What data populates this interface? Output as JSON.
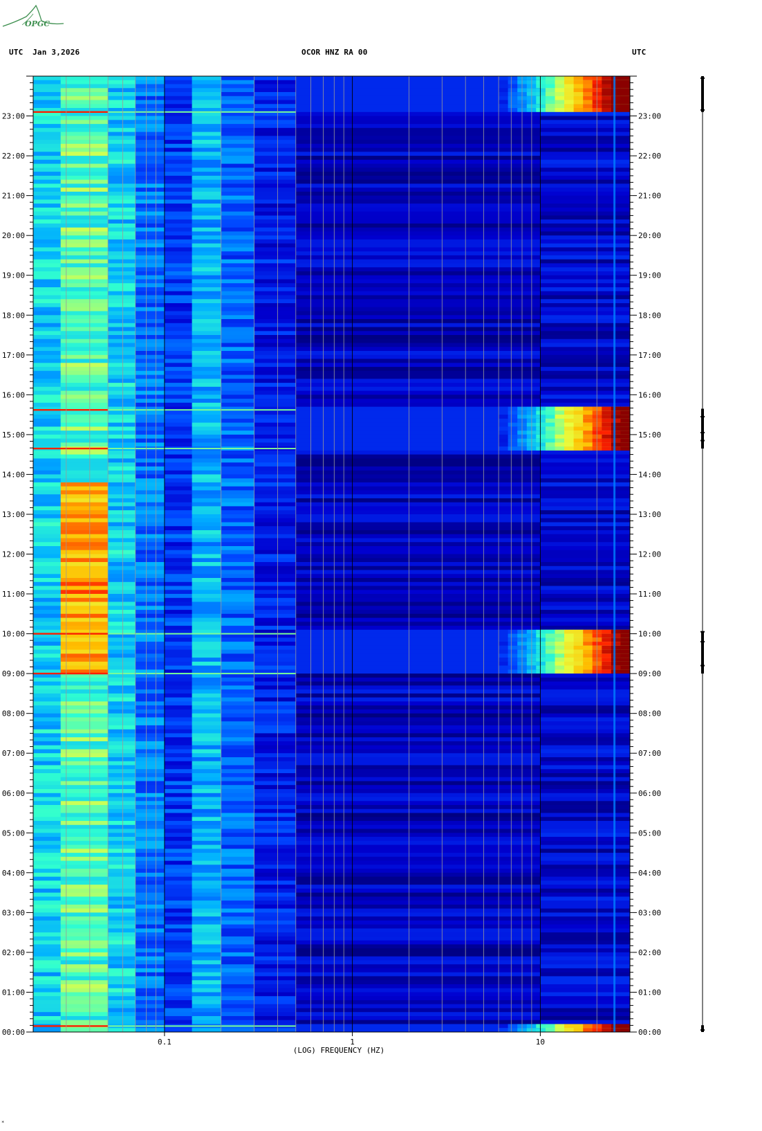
{
  "header": {
    "left": "UTC  Jan 3,2026",
    "center": "OCOR HNZ RA 00",
    "right": "UTC"
  },
  "logo": {
    "text": "OPGC",
    "color": "#3d8f4f"
  },
  "bottom_mark": "*",
  "chart_data": {
    "type": "heatmap",
    "title": "OCOR HNZ RA 00",
    "date": "Jan 3,2026",
    "xlabel": "(LOG) FREQUENCY (HZ)",
    "ylabel": "UTC",
    "x_scale": "log",
    "x_range_hz": [
      0.02,
      30
    ],
    "x_tick_values": [
      0.1,
      1,
      10
    ],
    "x_tick_labels": [
      "0.1",
      "1",
      "10"
    ],
    "y_range_hours": [
      0,
      24
    ],
    "y_tick_labels": [
      "00:00",
      "01:00",
      "02:00",
      "03:00",
      "04:00",
      "05:00",
      "06:00",
      "07:00",
      "08:00",
      "09:00",
      "10:00",
      "11:00",
      "12:00",
      "13:00",
      "14:00",
      "15:00",
      "16:00",
      "17:00",
      "18:00",
      "19:00",
      "20:00",
      "21:00",
      "22:00",
      "23:00"
    ],
    "colormap": [
      "#00007a",
      "#0000d0",
      "#0044ff",
      "#00b0ff",
      "#30ffd0",
      "#e8ff40",
      "#ffc000",
      "#ff2000",
      "#8a0000"
    ],
    "frequency_bands": [
      {
        "f_from": 0.02,
        "f_to": 0.028,
        "level": 0.42
      },
      {
        "f_from": 0.028,
        "f_to": 0.05,
        "level": 0.52
      },
      {
        "f_from": 0.05,
        "f_to": 0.07,
        "level": 0.42
      },
      {
        "f_from": 0.07,
        "f_to": 0.1,
        "level": 0.3
      },
      {
        "f_from": 0.1,
        "f_to": 0.14,
        "level": 0.22
      },
      {
        "f_from": 0.14,
        "f_to": 0.2,
        "level": 0.38
      },
      {
        "f_from": 0.2,
        "f_to": 0.3,
        "level": 0.28
      },
      {
        "f_from": 0.3,
        "f_to": 0.5,
        "level": 0.18
      },
      {
        "f_from": 0.5,
        "f_to": 10,
        "level": 0.1
      },
      {
        "f_from": 10,
        "f_to": 30,
        "level": 0.12
      }
    ],
    "high_activity_periods": [
      {
        "from_hour": 0.0,
        "to_hour": 0.17,
        "level": 0.95
      },
      {
        "from_hour": 9.0,
        "to_hour": 10.05,
        "level": 0.9
      },
      {
        "from_hour": 14.65,
        "to_hour": 15.65,
        "level": 0.9
      },
      {
        "from_hour": 23.1,
        "to_hour": 24.0,
        "level": 0.95
      }
    ],
    "broadband_lines_hours": [
      0.15,
      9.0,
      10.0,
      14.65,
      15.62,
      23.1
    ],
    "low_freq_enhanced_period": {
      "from_hour": 9.0,
      "to_hour": 13.8,
      "f_from": 0.028,
      "f_to": 0.05,
      "level": 0.72
    },
    "trace_markers_hours": [
      0.05,
      9.2,
      9.8,
      10.05,
      14.85,
      15.05,
      15.45,
      23.15,
      23.95
    ]
  }
}
